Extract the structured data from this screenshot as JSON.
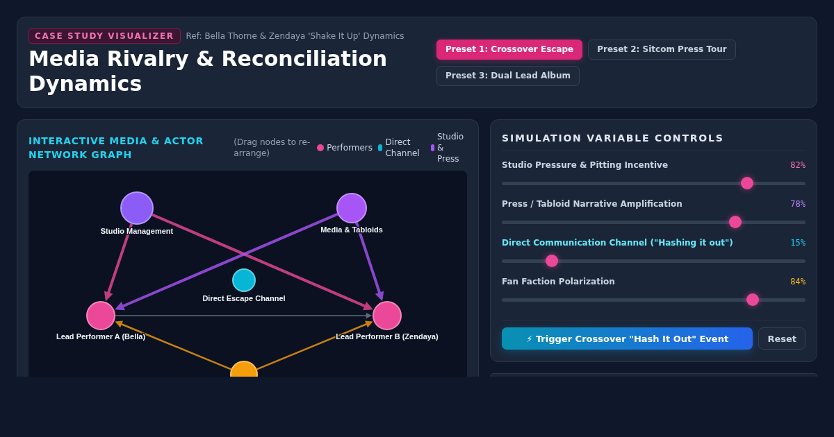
{
  "header": {
    "badge": "CASE STUDY VISUALIZER",
    "reference": "Ref: Bella Thorne & Zendaya 'Shake It Up' Dynamics",
    "title": "Media Rivalry & Reconciliation Dynamics",
    "presets": [
      {
        "label": "Preset 1: Crossover Escape",
        "selected": true
      },
      {
        "label": "Preset 2: Sitcom Press Tour",
        "selected": false
      },
      {
        "label": "Preset 3: Dual Lead Album",
        "selected": false
      }
    ]
  },
  "network_panel": {
    "title": "INTERACTIVE MEDIA & ACTOR NETWORK GRAPH",
    "hint": "(Drag nodes to re-arrange)",
    "legend": [
      {
        "label": "Performers",
        "color": "#ec4899"
      },
      {
        "label": "Direct Channel",
        "color": "#06b6d4"
      },
      {
        "label": "Studio & Press",
        "color": "#a855f7"
      }
    ],
    "graph": {
      "nodes": [
        {
          "label": "Studio Management",
          "color": "#8b5cf6"
        },
        {
          "label": "Media & Tabloids",
          "color": "#a855f7"
        },
        {
          "label": "Direct Escape Channel",
          "color": "#06b6d4"
        },
        {
          "label": "Lead Performer A (Bella)",
          "color": "#ec4899"
        },
        {
          "label": "Lead Performer B (Zendaya)",
          "color": "#ec4899"
        },
        {
          "color": "#f59e0b"
        }
      ]
    }
  },
  "controls_panel": {
    "title": "SIMULATION VARIABLE CONTROLS",
    "controls": [
      {
        "label": "Studio Pressure & Pitting Incentive",
        "value": "82%",
        "level": 0.82,
        "color": "#f472b6",
        "highlighted": false
      },
      {
        "label": "Press / Tabloid Narrative Amplification",
        "value": "78%",
        "level": 0.78,
        "color": "#c084fc",
        "highlighted": false
      },
      {
        "label": "Direct Communication Channel (\"Hashing it out\")",
        "value": "15%",
        "level": 0.15,
        "color": "#22d3ee",
        "highlighted": true
      },
      {
        "label": "Fan Faction Polarization",
        "value": "84%",
        "level": 0.84,
        "color": "#fbbf24",
        "highlighted": false
      }
    ],
    "actions": [
      {
        "label": "⚡ Trigger Crossover \"Hash It Out\" Event",
        "kind": "primary"
      },
      {
        "label": "Reset",
        "kind": "secondary"
      }
    ]
  }
}
